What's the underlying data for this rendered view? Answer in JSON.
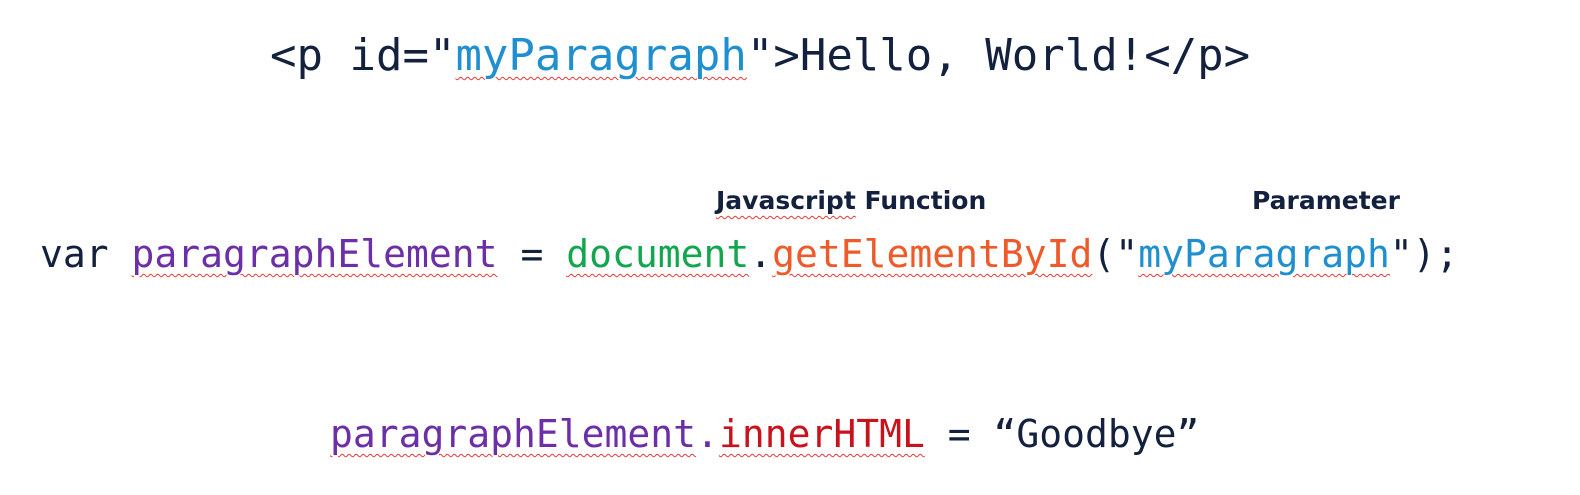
{
  "line1": {
    "open_tag_start": "<p id=\"",
    "id_value": "myParagraph",
    "open_tag_end": "\">",
    "text": "Hello, World!",
    "close_tag": "</p>"
  },
  "annotations": {
    "function_label_word1": "Javascript",
    "function_label_word2": " Function",
    "parameter_label": "Parameter"
  },
  "line2": {
    "keyword": "var ",
    "variable": "paragraphElement",
    "assign": " = ",
    "object": "document",
    "dot": ".",
    "method": "getElementById",
    "open": "(\"",
    "argument": "myParagraph",
    "close": "\");"
  },
  "line3": {
    "variable": "paragraphElement",
    "dot": ".",
    "property": "innerHTML",
    "assign": " = ",
    "value": "“Goodbye”"
  },
  "colors": {
    "text": "#13213f",
    "parameter": "#1f8fd0",
    "variable": "#6c2fa8",
    "object": "#12a64f",
    "method": "#ee5a2a",
    "property": "#c8121c",
    "spellcheck_underline": "#e53935"
  }
}
